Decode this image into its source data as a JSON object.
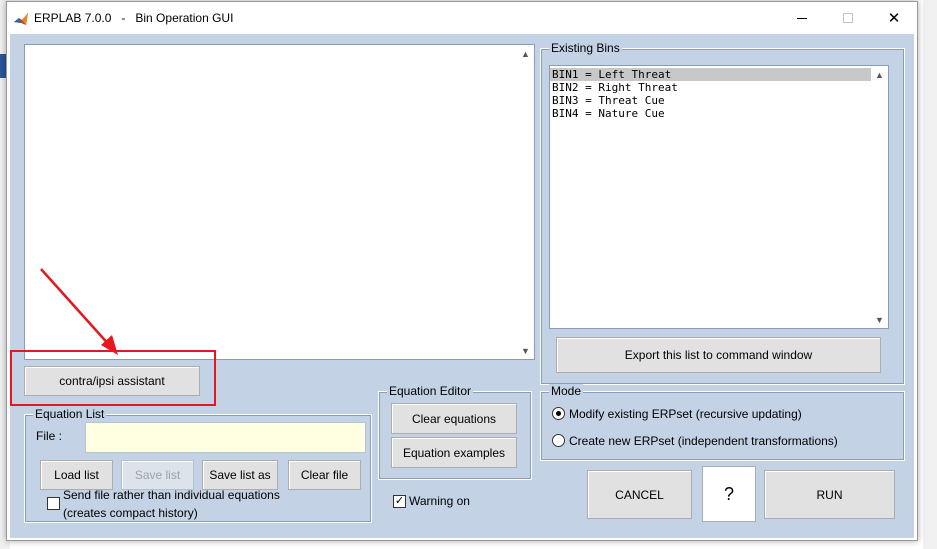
{
  "window": {
    "app_title": "ERPLAB 7.0.0   -   Bin Operation GUI",
    "close_glyph": "✕"
  },
  "editor": {
    "up_arrow": "▲",
    "down_arrow": "▼"
  },
  "contra_ipsi_button": "contra/ipsi assistant",
  "existing_bins": {
    "title": "Existing Bins",
    "items": [
      "BIN1 = Left Threat",
      "BIN2 = Right Threat",
      "BIN3 = Threat Cue",
      "BIN4 = Nature Cue"
    ],
    "selected_index": 0,
    "export_button": "Export this list to command window"
  },
  "equation_editor": {
    "title": "Equation Editor",
    "clear_button": "Clear equations",
    "examples_button": "Equation examples"
  },
  "mode": {
    "title": "Mode",
    "option_modify": "Modify existing ERPset (recursive updating)",
    "option_create": "Create new ERPset (independent transformations)",
    "selected": "modify"
  },
  "equation_list": {
    "title": "Equation List",
    "file_label": "File :",
    "file_value": "",
    "load_button": "Load list",
    "save_button": "Save list",
    "save_as_button": "Save list as",
    "clear_file_button": "Clear file",
    "send_file_line1": "Send file rather than individual equations",
    "send_file_line2": "(creates compact history)",
    "send_file_checked": false
  },
  "warning": {
    "label": "Warning on",
    "checked": true,
    "check_glyph": "✓"
  },
  "actions": {
    "cancel": "CANCEL",
    "help": "?",
    "run": "RUN"
  },
  "colors": {
    "panel_bg": "#c3d2e4",
    "file_field_bg": "#ffffe1",
    "annotation_red": "#e3191f",
    "selected_row": "#c8c8c8"
  }
}
